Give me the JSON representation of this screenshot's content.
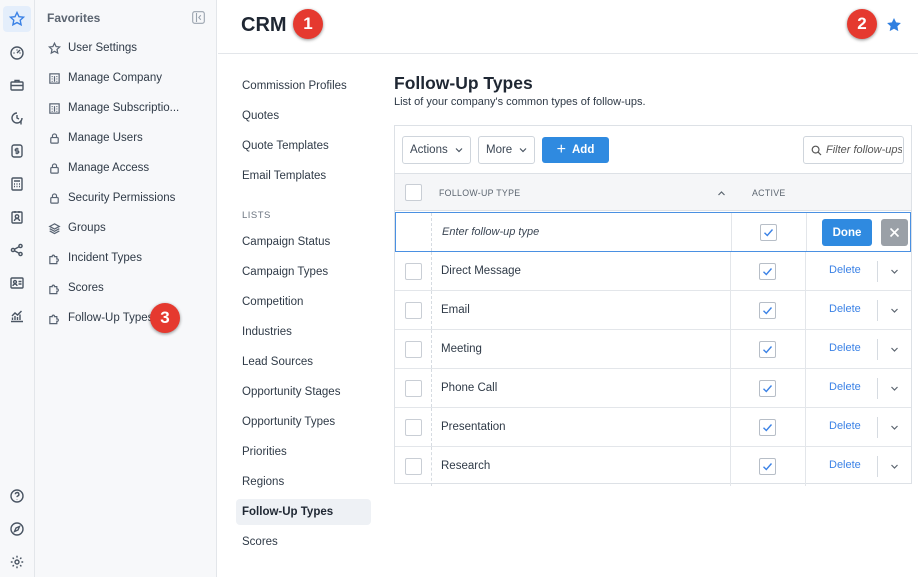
{
  "header": {
    "title": "CRM"
  },
  "favorites": {
    "title": "Favorites",
    "items": [
      {
        "label": "User Settings",
        "icon": "star-outline-icon"
      },
      {
        "label": "Manage Company",
        "icon": "building-icon"
      },
      {
        "label": "Manage Subscriptio...",
        "icon": "building-icon"
      },
      {
        "label": "Manage Users",
        "icon": "lock-icon"
      },
      {
        "label": "Manage Access",
        "icon": "lock-icon"
      },
      {
        "label": "Security Permissions",
        "icon": "lock-icon"
      },
      {
        "label": "Groups",
        "icon": "layers-icon"
      },
      {
        "label": "Incident Types",
        "icon": "puzzle-icon"
      },
      {
        "label": "Scores",
        "icon": "puzzle-icon"
      },
      {
        "label": "Follow-Up Types",
        "icon": "puzzle-icon"
      }
    ]
  },
  "rail": {
    "top": [
      "star-icon",
      "dashboard-icon",
      "briefcase-icon",
      "clock-dollar-icon",
      "dollar-icon",
      "calculator-icon",
      "contact-icon",
      "share-icon",
      "id-card-icon",
      "analytics-icon"
    ],
    "bottom": [
      "help-icon",
      "compass-icon",
      "settings-icon"
    ]
  },
  "subnav": {
    "items": [
      "Commission Profiles",
      "Quotes",
      "Quote Templates",
      "Email Templates"
    ],
    "section_label": "LISTS",
    "list_items": [
      "Campaign Status",
      "Campaign Types",
      "Competition",
      "Industries",
      "Lead Sources",
      "Opportunity Stages",
      "Opportunity Types",
      "Priorities",
      "Regions",
      "Follow-Up Types",
      "Scores"
    ],
    "active": "Follow-Up Types"
  },
  "content": {
    "title": "Follow-Up Types",
    "description": "List of your company's common types of follow-ups."
  },
  "toolbar": {
    "actions_label": "Actions",
    "more_label": "More",
    "add_label": "Add",
    "filter_placeholder": "Filter follow-ups"
  },
  "table": {
    "columns": [
      "FOLLOW-UP TYPE",
      "ACTIVE"
    ],
    "edit_row": {
      "placeholder": "Enter follow-up type",
      "active": true,
      "done_label": "Done"
    },
    "delete_label": "Delete",
    "rows": [
      {
        "name": "Direct Message",
        "active": true
      },
      {
        "name": "Email",
        "active": true
      },
      {
        "name": "Meeting",
        "active": true
      },
      {
        "name": "Phone Call",
        "active": true
      },
      {
        "name": "Presentation",
        "active": true
      },
      {
        "name": "Research",
        "active": true
      }
    ]
  },
  "annotations": [
    "1",
    "2",
    "3"
  ],
  "colors": {
    "accent": "#2f8ae0",
    "badge": "#e5392f",
    "link": "#3b82e6"
  }
}
